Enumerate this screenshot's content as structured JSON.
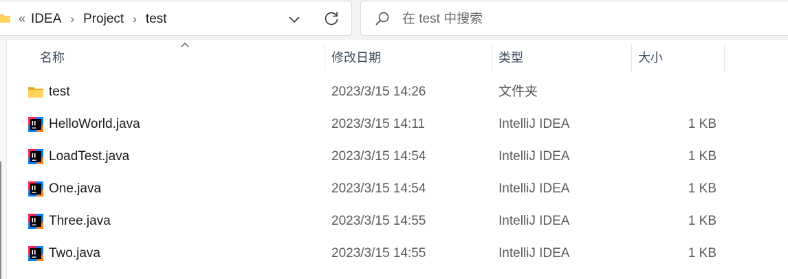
{
  "address_bar": {
    "overflow_glyph": "«",
    "breadcrumbs": [
      "IDEA",
      "Project",
      "test"
    ],
    "separator": "›"
  },
  "search": {
    "placeholder": "在 test 中搜索"
  },
  "columns": {
    "name": "名称",
    "date": "修改日期",
    "type": "类型",
    "size": "大小"
  },
  "files": [
    {
      "name": "test",
      "date": "2023/3/15 14:26",
      "type": "文件夹",
      "size": "",
      "icon": "folder-icon"
    },
    {
      "name": "HelloWorld.java",
      "date": "2023/3/15 14:11",
      "type": "IntelliJ IDEA",
      "size": "1 KB",
      "icon": "intellij-java-file-icon"
    },
    {
      "name": "LoadTest.java",
      "date": "2023/3/15 14:54",
      "type": "IntelliJ IDEA",
      "size": "1 KB",
      "icon": "intellij-java-file-icon"
    },
    {
      "name": "One.java",
      "date": "2023/3/15 14:54",
      "type": "IntelliJ IDEA",
      "size": "1 KB",
      "icon": "intellij-java-file-icon"
    },
    {
      "name": "Three.java",
      "date": "2023/3/15 14:55",
      "type": "IntelliJ IDEA",
      "size": "1 KB",
      "icon": "intellij-java-file-icon"
    },
    {
      "name": "Two.java",
      "date": "2023/3/15 14:55",
      "type": "IntelliJ IDEA",
      "size": "1 KB",
      "icon": "intellij-java-file-icon"
    }
  ],
  "colors": {
    "folder": "#f6c453",
    "intellij_dark": "#000000",
    "intellij_accent_pink": "#fe2857",
    "intellij_accent_blue": "#087cfa",
    "intellij_accent_orange": "#fc801d"
  }
}
